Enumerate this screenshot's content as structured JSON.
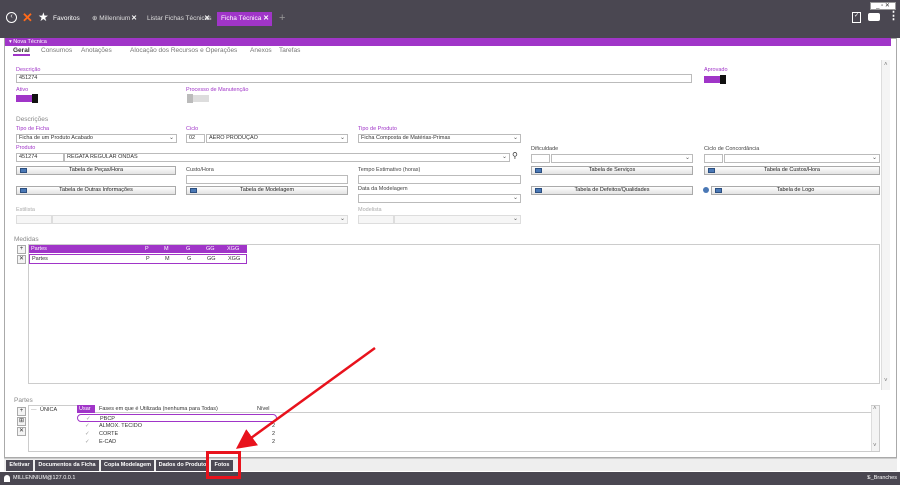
{
  "topbar": {
    "favorites_label": "Favoritos",
    "tabs": [
      {
        "label": "⊕ Millennium"
      },
      {
        "label": "Listar Fichas Técnicas"
      },
      {
        "label": "Ficha Técnica"
      }
    ],
    "add_tab": "+",
    "window_controls": "_ ▫ ✕",
    "accent": "#a035c8"
  },
  "panel": {
    "title": "▾ Nova Técnica",
    "subtabs": [
      "Geral",
      "Consumos",
      "Anotações",
      "Alocação dos Recursos e Operações",
      "Anexos",
      "Tarefas"
    ]
  },
  "form": {
    "descricao_label": "Descrição",
    "descricao_value": "451274",
    "aprovado_label": "Aprovado",
    "ativo_label": "Ativo",
    "processo_label": "Processo de Manutenção",
    "descricoes_section": "Descrições",
    "tipo_ficha_label": "Tipo de Ficha",
    "tipo_ficha_value": "Ficha de um Produto Acabado",
    "ciclo_label": "Ciclo",
    "ciclo_code": "02",
    "ciclo_value": "AERO PRODUÇÃO",
    "tipo_produto_label": "Tipo de Produto",
    "tipo_produto_value": "Ficha Composta de Matérias-Primas",
    "produto_label": "Produto",
    "produto_code": "451274",
    "produto_value": "REGATA REGULAR ONDAS",
    "dificuldade_label": "Dificuldade",
    "ciclo_concordancia_label": "Ciclo de Concordância",
    "btn_tabela_pecas": "Tabela de Peças/Hora",
    "custo_hora_label": "Custo/Hora",
    "tempo_estimativo_label": "Tempo Estimativo (horas)",
    "btn_tabela_servicos": "Tabela de Serviços",
    "btn_tabela_custos": "Tabela de Custos/Hora",
    "btn_outras_info": "Tabela de Outras Informações",
    "btn_modelagem": "Tabela de Modelagem",
    "data_modelagem_label": "Data da Modelagem",
    "btn_defeitos": "Tabela de Defeitos/Qualidades",
    "btn_logo": "Tabela de Logo",
    "estilista_label": "Estilista",
    "modelista_label": "Modelista"
  },
  "medidas": {
    "label": "Medidas",
    "headers": [
      "Partes",
      "P",
      "M",
      "G",
      "GG",
      "XGG"
    ],
    "row": [
      "Partes",
      "P",
      "M",
      "G",
      "GG",
      "XGG"
    ]
  },
  "partes": {
    "label": "Partes",
    "tree_item": "ÚNICA",
    "headers": [
      "Usar",
      "Fases em que é Utilizada (nenhuma para Todas)",
      "Nível"
    ],
    "rows": [
      {
        "fase": "PBCP",
        "nivel": ""
      },
      {
        "fase": "ALMOX. TECIDO",
        "nivel": "2"
      },
      {
        "fase": "CORTE",
        "nivel": "2"
      },
      {
        "fase": "E-CAD",
        "nivel": "2"
      }
    ]
  },
  "bottom_buttons": [
    "Efetivar",
    "Documentos da Ficha",
    "Copia Modelagem",
    "Dados do Produto",
    "Fotos"
  ],
  "status": {
    "left": "MILLENNIUM@127.0.0.1",
    "right": "S_Branches"
  }
}
